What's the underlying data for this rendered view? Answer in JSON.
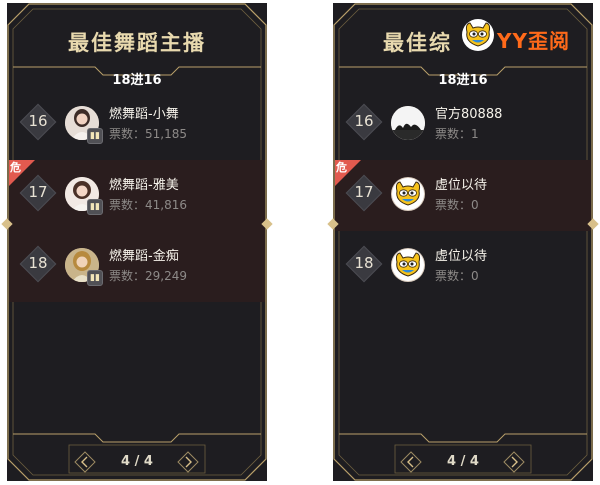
{
  "colors": {
    "panel_bg": "#1e1d21",
    "gold": "#d8c08a",
    "danger_row": "#2a1d1e",
    "danger_tag": "#e25a4f",
    "brand_orange": "#ff6a1a"
  },
  "watermark": {
    "text": "YY歪阅"
  },
  "panels": [
    {
      "title": "最佳舞蹈主播",
      "round": "18进16",
      "page": "4 / 4",
      "rows": [
        {
          "rank": "16",
          "name": "燃舞蹈-小舞",
          "votes": "票数：51,185",
          "danger": false,
          "avatar": "girl-avatar-icon"
        },
        {
          "rank": "17",
          "name": "燃舞蹈-雅美",
          "votes": "票数：41,816",
          "danger": true,
          "danger_label": "危",
          "avatar": "girl-avatar-icon"
        },
        {
          "rank": "18",
          "name": "燃舞蹈-金痴",
          "votes": "票数：29,249",
          "danger": true,
          "avatar": "girl-avatar-icon"
        }
      ]
    },
    {
      "title": "最佳综",
      "round": "18进16",
      "page": "4 / 4",
      "rows": [
        {
          "rank": "16",
          "name": "官方80888",
          "votes": "票数：1",
          "danger": false,
          "avatar": "camel-silhouette-icon"
        },
        {
          "rank": "17",
          "name": "虚位以待",
          "votes": "票数：0",
          "danger": true,
          "danger_label": "危",
          "avatar": "yy-mascot-icon"
        },
        {
          "rank": "18",
          "name": "虚位以待",
          "votes": "票数：0",
          "danger": false,
          "avatar": "yy-mascot-icon"
        }
      ]
    }
  ]
}
